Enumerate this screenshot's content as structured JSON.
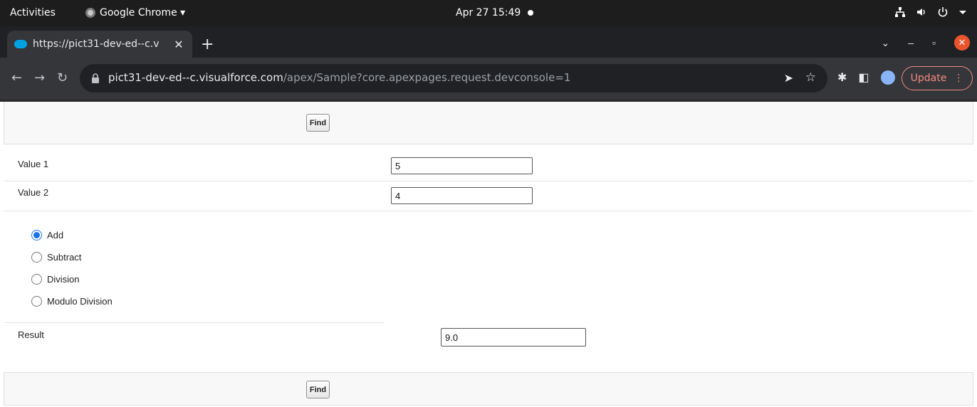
{
  "os_topbar": {
    "activities": "Activities",
    "app_menu": "Google Chrome ▾",
    "clock": "Apr 27  15:49"
  },
  "browser": {
    "tab_title": "https://pict31-dev-ed--c.v",
    "new_tab": "+",
    "url_host": "pict31-dev-ed--c.visualforce.com",
    "url_path": "/apex/Sample?core.apexpages.request.devconsole=1",
    "update_label": "Update",
    "update_more": "⋮"
  },
  "form": {
    "find_label": "Find",
    "value1_label": "Value 1",
    "value1": "5",
    "value2_label": "Value 2",
    "value2": "4",
    "operations": [
      {
        "label": "Add",
        "checked": true
      },
      {
        "label": "Subtract",
        "checked": false
      },
      {
        "label": "Division",
        "checked": false
      },
      {
        "label": "Modulo Division",
        "checked": false
      }
    ],
    "result_label": "Result",
    "result": "9.0"
  },
  "colors": {
    "accent_radio": "#1a73e8",
    "update_red": "#f28b82",
    "salesforce_blue": "#00a1e0"
  }
}
